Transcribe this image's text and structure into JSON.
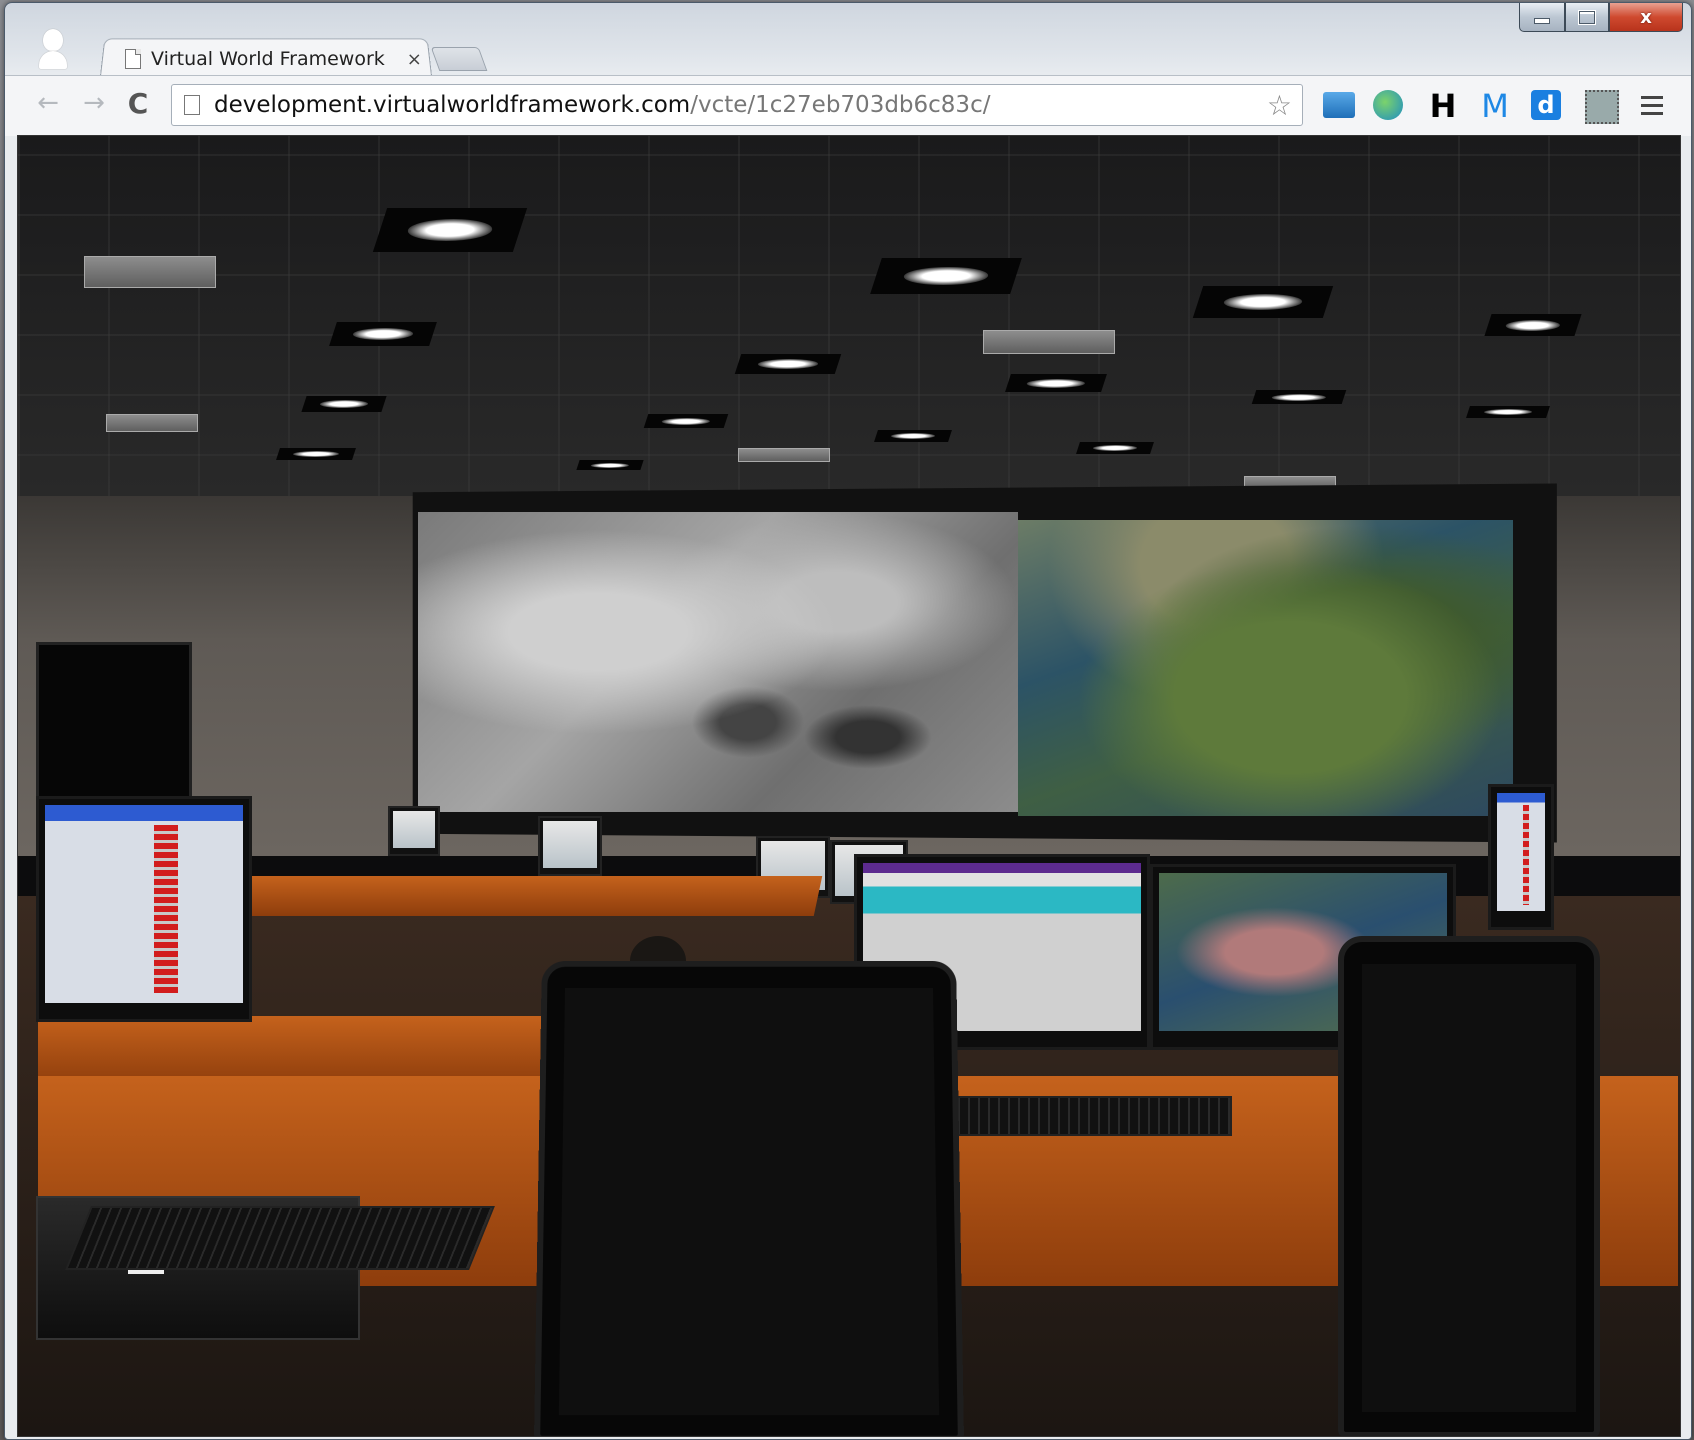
{
  "window": {
    "minimize_icon": "minimize-icon",
    "maximize_icon": "maximize-icon",
    "close_label": "x"
  },
  "tabs": [
    {
      "title": "Virtual World Framework",
      "close_label": "×",
      "active": true
    }
  ],
  "toolbar": {
    "back_glyph": "←",
    "forward_glyph": "→",
    "reload_glyph": "C"
  },
  "address": {
    "host": "development.virtualworldframework.com",
    "path": "/vcte/1c27eb703db6c83c/"
  },
  "extensions": [
    {
      "name": "screenshot-extension-icon",
      "label": ""
    },
    {
      "name": "globe-extension-icon",
      "label": ""
    },
    {
      "name": "h-extension-icon",
      "label": "H"
    },
    {
      "name": "m-extension-icon",
      "label": "M"
    },
    {
      "name": "d-extension-icon",
      "label": "d"
    },
    {
      "name": "evernote-extension-icon",
      "label": ""
    }
  ],
  "colors": {
    "close_button": "#c9432a",
    "desk_orange": "#c5621c",
    "center_monitor_header": "#5d2b8f",
    "center_monitor_highlight": "#2bb8c4"
  }
}
